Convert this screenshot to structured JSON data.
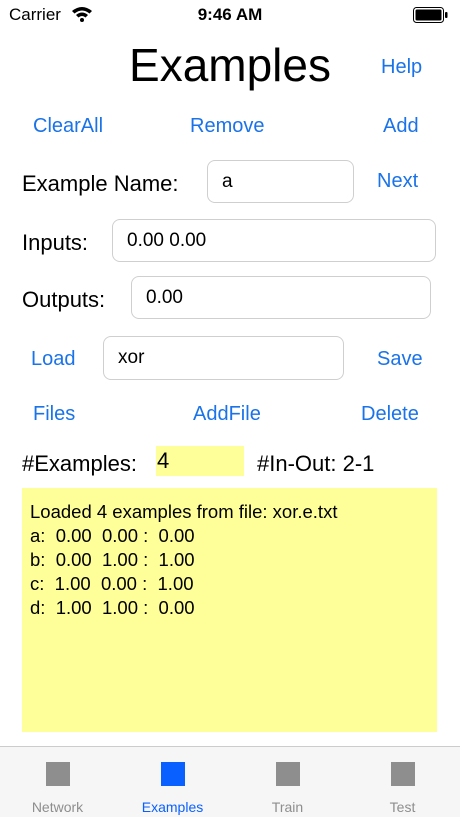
{
  "status_bar": {
    "carrier": "Carrier",
    "time": "9:46 AM"
  },
  "header": {
    "title": "Examples",
    "help_label": "Help"
  },
  "toolbar": {
    "clear_all_label": "ClearAll",
    "remove_label": "Remove",
    "add_label": "Add"
  },
  "example": {
    "name_label": "Example Name:",
    "name_value": "a",
    "next_label": "Next"
  },
  "inputs": {
    "label": "Inputs:",
    "value": "0.00 0.00"
  },
  "outputs": {
    "label": "Outputs:",
    "value": "0.00"
  },
  "file": {
    "load_label": "Load",
    "name_value": "xor",
    "save_label": "Save"
  },
  "file_actions": {
    "files_label": "Files",
    "add_file_label": "AddFile",
    "delete_label": "Delete"
  },
  "summary": {
    "examples_label": "#Examples:",
    "examples_count": "4",
    "in_out_label": "#In-Out: 2-1"
  },
  "log": {
    "lines": [
      "Loaded 4 examples from file: xor.e.txt",
      "a:  0.00  0.00 :  0.00",
      "b:  0.00  1.00 :  1.00",
      "c:  1.00  0.00 :  1.00",
      "d:  1.00  1.00 :  0.00"
    ]
  },
  "tabs": [
    {
      "label": "Network",
      "active": false,
      "icon": "network-tab-icon"
    },
    {
      "label": "Examples",
      "active": true,
      "icon": "examples-tab-icon"
    },
    {
      "label": "Train",
      "active": false,
      "icon": "train-tab-icon"
    },
    {
      "label": "Test",
      "active": false,
      "icon": "test-tab-icon"
    }
  ],
  "colors": {
    "accent": "#1a73e8",
    "highlight": "#ffff99",
    "tab_active": "#0a60ff",
    "tab_inactive": "#8e8e8e"
  }
}
